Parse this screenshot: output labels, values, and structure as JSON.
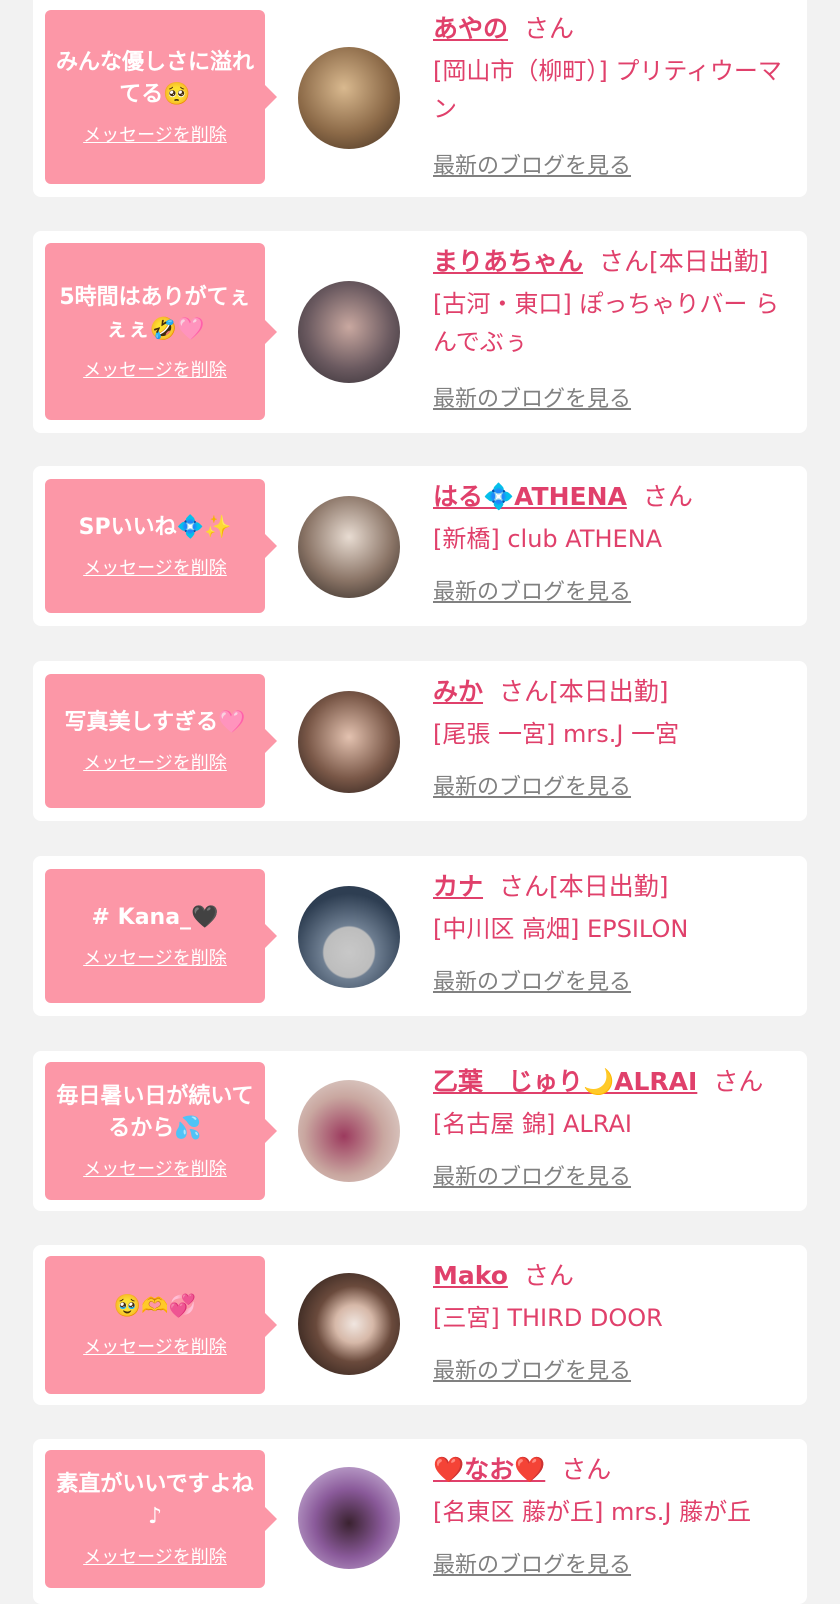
{
  "colors": {
    "accent": "#e0406b",
    "bubble": "#fc97a7",
    "link_gray": "#808080",
    "bg": "#f2f2f2"
  },
  "items": [
    {
      "message": "みんな優しさに溢れてる🥺",
      "delete_label": "メッセージを削除",
      "name": "あやの",
      "suffix": "さん",
      "shop": "[岡山市（柳町）] プリティウーマン",
      "blog_label": "最新のブログを見る"
    },
    {
      "message": "5時間はありがてぇぇぇ🤣🩷",
      "delete_label": "メッセージを削除",
      "name": "まりあちゃん",
      "suffix": "さん[本日出勤]",
      "shop": "[古河・東口] ぽっちゃりバー らんでぶぅ",
      "blog_label": "最新のブログを見る"
    },
    {
      "message": "SPいいね💠✨",
      "delete_label": "メッセージを削除",
      "name": "はる💠ATHENA",
      "suffix": "さん",
      "shop": "[新橋] club ATHENA",
      "blog_label": "最新のブログを見る"
    },
    {
      "message": "写真美しすぎる🩷",
      "delete_label": "メッセージを削除",
      "name": "みか",
      "suffix": "さん[本日出勤]",
      "shop": "[尾張 一宮] mrs.J 一宮",
      "blog_label": "最新のブログを見る"
    },
    {
      "message": "# Kana_🖤",
      "delete_label": "メッセージを削除",
      "name": "カナ",
      "suffix": "さん[本日出勤]",
      "shop": "[中川区 高畑] EPSILON",
      "blog_label": "最新のブログを見る"
    },
    {
      "message": "毎日暑い日が続いてるから💦",
      "delete_label": "メッセージを削除",
      "name": "乙葉　じゅり🌙ALRAI",
      "suffix": "さん",
      "shop": "[名古屋 錦] ALRAI",
      "blog_label": "最新のブログを見る"
    },
    {
      "message": "🥹🫶💞",
      "delete_label": "メッセージを削除",
      "name": "Mako",
      "suffix": "さん",
      "shop": "[三宮] THIRD DOOR",
      "blog_label": "最新のブログを見る"
    },
    {
      "message": "素直がいいですよね♪",
      "delete_label": "メッセージを削除",
      "name": "❤️なお❤️",
      "suffix": "さん",
      "shop": "[名東区 藤が丘] mrs.J 藤が丘",
      "blog_label": "最新のブログを見る"
    }
  ]
}
